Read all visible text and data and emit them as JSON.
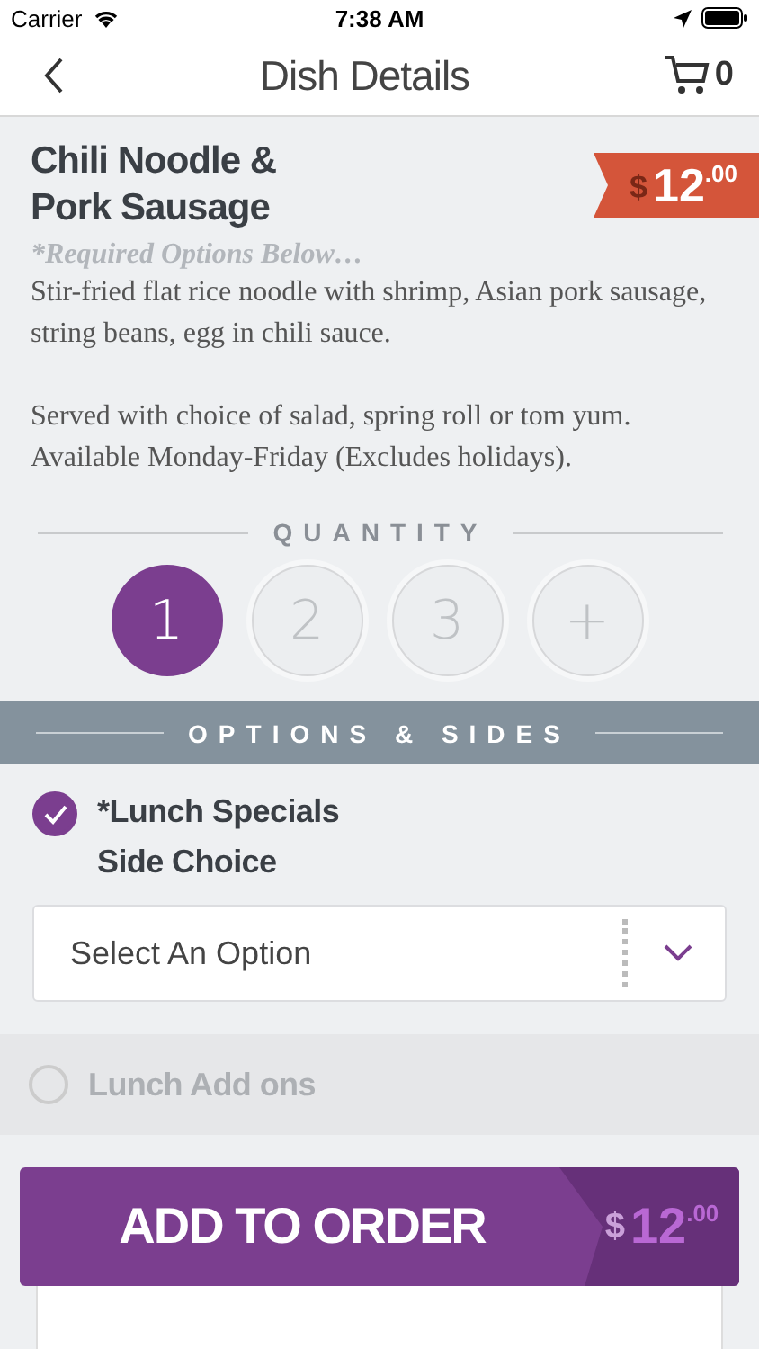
{
  "status_bar": {
    "carrier": "Carrier",
    "time": "7:38 AM"
  },
  "nav": {
    "title": "Dish Details",
    "cart_count": "0"
  },
  "dish": {
    "name_lines": [
      "Chili Noodle &",
      "Pork Sausage"
    ],
    "price": {
      "currency": "$",
      "whole": "12",
      "cents": ".00"
    },
    "required_note": "*Required Options Below…",
    "description": [
      "Stir-fried flat rice noodle with shrimp, Asian pork sausage, string beans, egg in chili sauce.",
      "Served with choice of salad, spring roll or tom yum. Available Monday-Friday (Excludes holidays)."
    ]
  },
  "quantity": {
    "label": "QUANTITY",
    "options": [
      {
        "label": "1",
        "selected": true
      },
      {
        "label": "2",
        "selected": false
      },
      {
        "label": "3",
        "selected": false
      },
      {
        "label": "+",
        "selected": false
      }
    ]
  },
  "options_header": "OPTIONS & SIDES",
  "option_groups": [
    {
      "title_lines": [
        "*Lunch Specials",
        "Side Choice"
      ],
      "checked": true,
      "disabled": false,
      "select": {
        "placeholder": "Select An Option"
      }
    },
    {
      "title_lines": [
        "Lunch Add ons"
      ],
      "checked": false,
      "disabled": true
    }
  ],
  "add_button": {
    "label": "ADD TO ORDER",
    "price": {
      "currency": "$",
      "whole": "12",
      "cents": ".00"
    }
  }
}
